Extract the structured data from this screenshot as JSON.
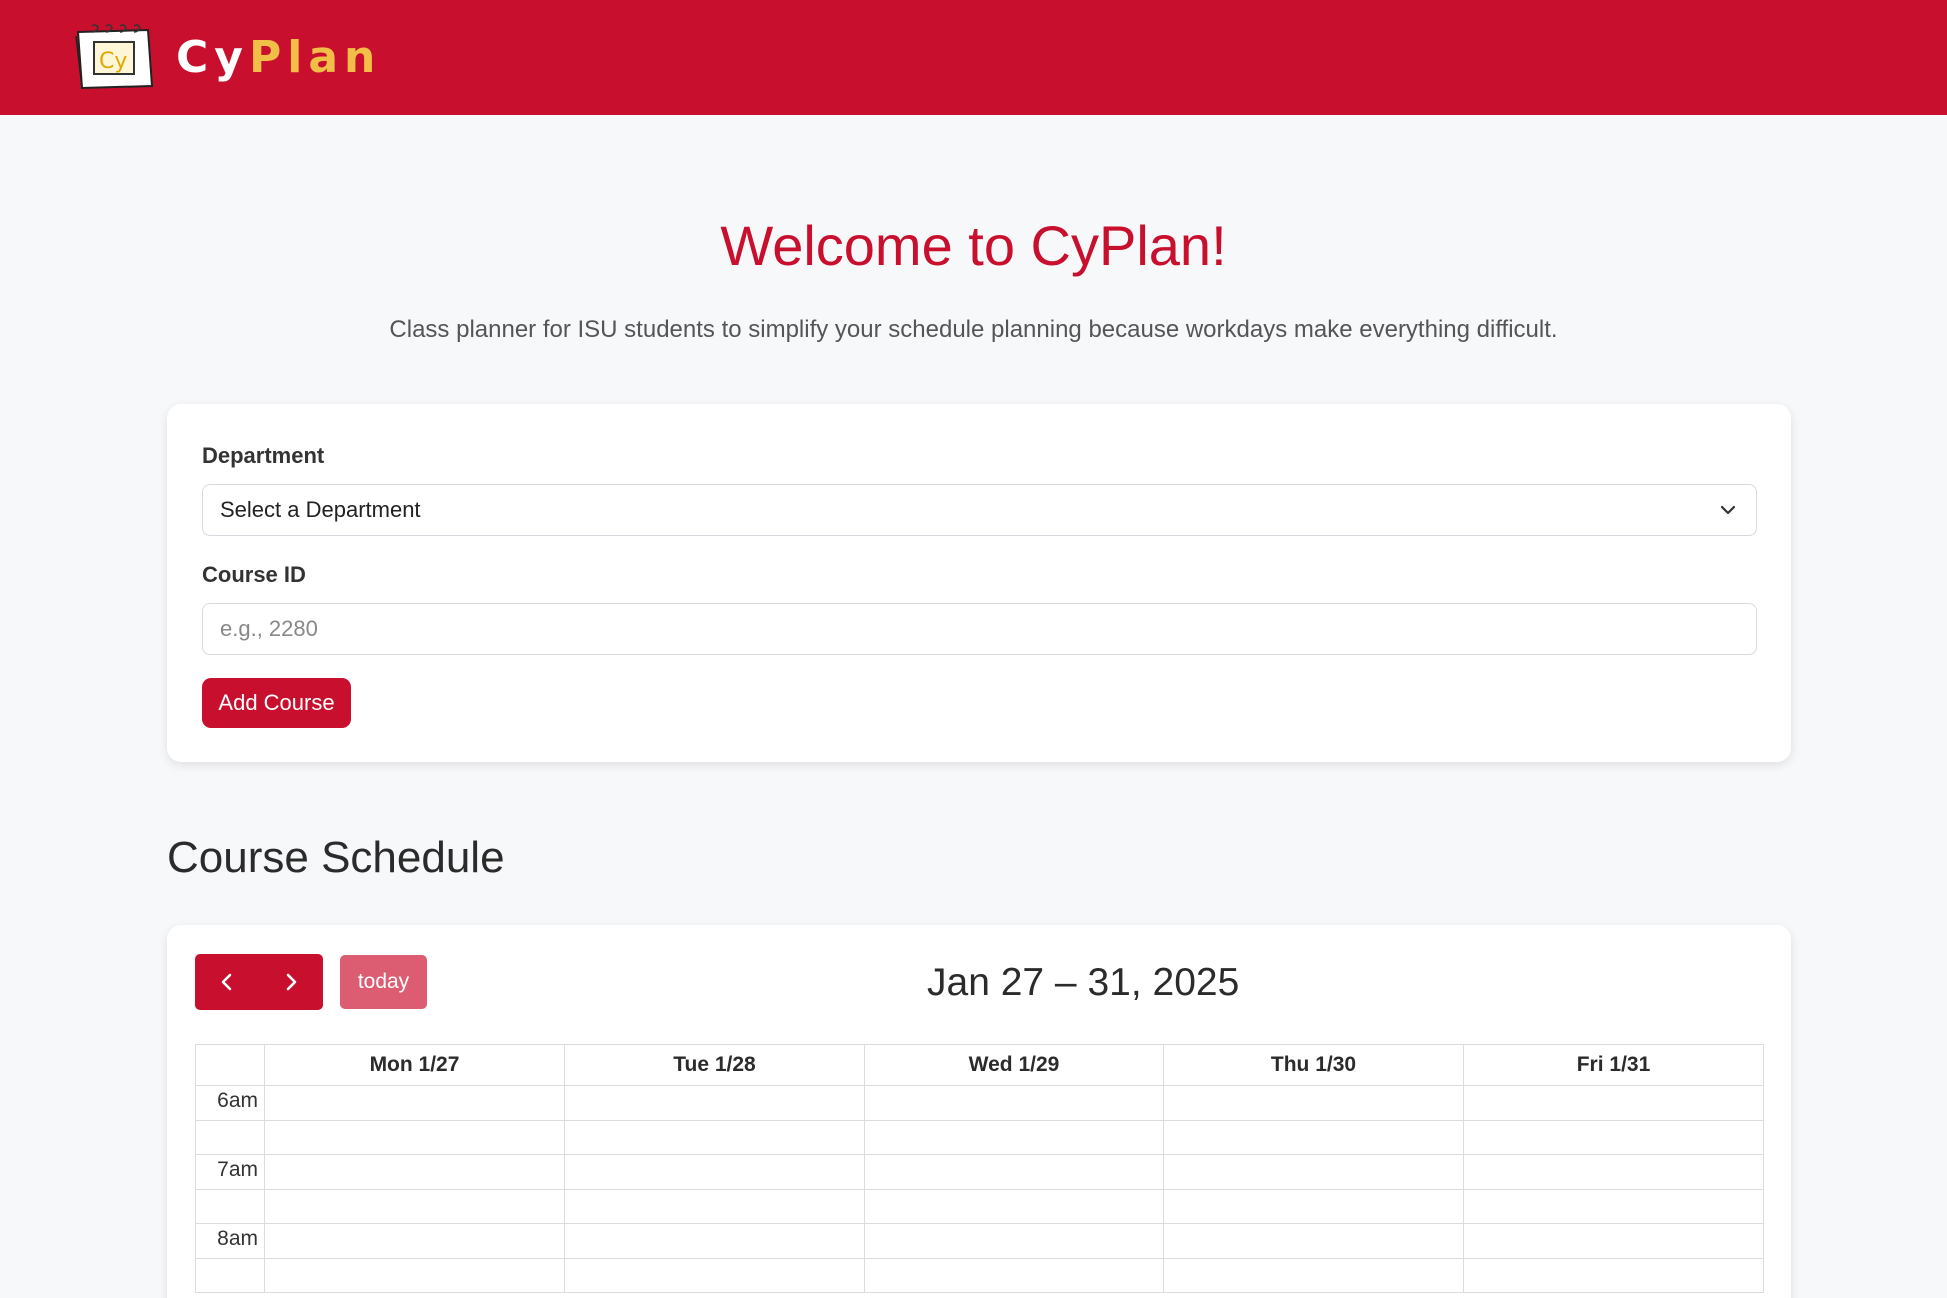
{
  "header": {
    "brand_part1": "Cy",
    "brand_part2": "Plan",
    "logo_text": "Cy",
    "brand_color": "#c8102e",
    "accent_color": "#f1be48"
  },
  "hero": {
    "title": "Welcome to CyPlan!",
    "subtitle": "Class planner for ISU students to simplify your schedule planning because workdays make everything difficult."
  },
  "form": {
    "department_label": "Department",
    "department_value": "Select a Department",
    "course_id_label": "Course ID",
    "course_id_placeholder": "e.g., 2280",
    "add_button": "Add Course"
  },
  "schedule": {
    "section_title": "Course Schedule",
    "today_label": "today",
    "range_title": "Jan 27 – 31, 2025",
    "days": [
      "Mon 1/27",
      "Tue 1/28",
      "Wed 1/29",
      "Thu 1/30",
      "Fri 1/31"
    ],
    "times": [
      "6am",
      "7am",
      "8am"
    ]
  }
}
